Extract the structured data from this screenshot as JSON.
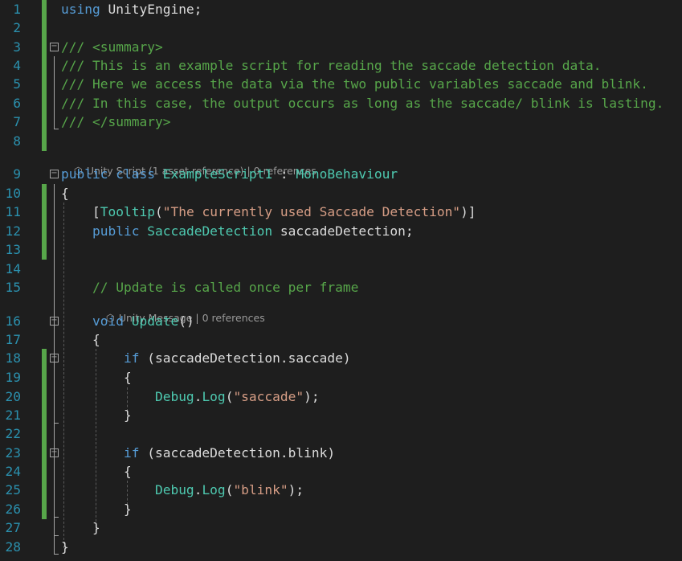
{
  "editor": {
    "lines": [
      {
        "n": "1",
        "segs": [
          {
            "c": "kw",
            "t": "using"
          },
          {
            "c": "plain",
            "t": " UnityEngine;"
          }
        ]
      },
      {
        "n": "2",
        "segs": []
      },
      {
        "n": "3",
        "segs": [
          {
            "c": "cm",
            "t": "/// <summary>"
          }
        ]
      },
      {
        "n": "4",
        "segs": [
          {
            "c": "cm",
            "t": "/// This is an example script for reading the saccade detection data."
          }
        ]
      },
      {
        "n": "5",
        "segs": [
          {
            "c": "cm",
            "t": "/// Here we access the data via the two public variables saccade and blink."
          }
        ]
      },
      {
        "n": "6",
        "segs": [
          {
            "c": "cm",
            "t": "/// In this case, the output occurs as long as the saccade/ blink is lasting."
          }
        ]
      },
      {
        "n": "7",
        "segs": [
          {
            "c": "cm",
            "t": "/// </summary>"
          }
        ]
      },
      {
        "n": "8",
        "segs": []
      },
      {
        "n": "9",
        "segs": [
          {
            "c": "kw",
            "t": "public"
          },
          {
            "c": "plain",
            "t": " "
          },
          {
            "c": "kw",
            "t": "class"
          },
          {
            "c": "plain",
            "t": " "
          },
          {
            "c": "type",
            "t": "ExampleScript1"
          },
          {
            "c": "plain",
            "t": " : "
          },
          {
            "c": "type",
            "t": "MonoBehaviour"
          }
        ]
      },
      {
        "n": "10",
        "segs": [
          {
            "c": "plain",
            "t": "{"
          }
        ]
      },
      {
        "n": "11",
        "segs": [
          {
            "c": "plain",
            "t": "    ["
          },
          {
            "c": "type",
            "t": "Tooltip"
          },
          {
            "c": "plain",
            "t": "("
          },
          {
            "c": "str",
            "t": "\"The currently used Saccade Detection\""
          },
          {
            "c": "plain",
            "t": ")]"
          }
        ]
      },
      {
        "n": "12",
        "segs": [
          {
            "c": "plain",
            "t": "    "
          },
          {
            "c": "kw",
            "t": "public"
          },
          {
            "c": "plain",
            "t": " "
          },
          {
            "c": "type",
            "t": "SaccadeDetection"
          },
          {
            "c": "plain",
            "t": " saccadeDetection;"
          }
        ]
      },
      {
        "n": "13",
        "segs": []
      },
      {
        "n": "14",
        "segs": []
      },
      {
        "n": "15",
        "segs": [
          {
            "c": "plain",
            "t": "    "
          },
          {
            "c": "cm",
            "t": "// Update is called once per frame"
          }
        ]
      },
      {
        "n": "16",
        "segs": [
          {
            "c": "plain",
            "t": "    "
          },
          {
            "c": "kw",
            "t": "void"
          },
          {
            "c": "plain",
            "t": " "
          },
          {
            "c": "type",
            "t": "Update"
          },
          {
            "c": "plain",
            "t": "()"
          }
        ]
      },
      {
        "n": "17",
        "segs": [
          {
            "c": "plain",
            "t": "    {"
          }
        ]
      },
      {
        "n": "18",
        "segs": [
          {
            "c": "plain",
            "t": "        "
          },
          {
            "c": "kw",
            "t": "if"
          },
          {
            "c": "plain",
            "t": " (saccadeDetection.saccade)"
          }
        ]
      },
      {
        "n": "19",
        "segs": [
          {
            "c": "plain",
            "t": "        {"
          }
        ]
      },
      {
        "n": "20",
        "segs": [
          {
            "c": "plain",
            "t": "            "
          },
          {
            "c": "type",
            "t": "Debug"
          },
          {
            "c": "plain",
            "t": "."
          },
          {
            "c": "type",
            "t": "Log"
          },
          {
            "c": "plain",
            "t": "("
          },
          {
            "c": "str",
            "t": "\"saccade\""
          },
          {
            "c": "plain",
            "t": ");"
          }
        ]
      },
      {
        "n": "21",
        "segs": [
          {
            "c": "plain",
            "t": "        }"
          }
        ]
      },
      {
        "n": "22",
        "segs": []
      },
      {
        "n": "23",
        "segs": [
          {
            "c": "plain",
            "t": "        "
          },
          {
            "c": "kw",
            "t": "if"
          },
          {
            "c": "plain",
            "t": " (saccadeDetection.blink)"
          }
        ]
      },
      {
        "n": "24",
        "segs": [
          {
            "c": "plain",
            "t": "        {"
          }
        ]
      },
      {
        "n": "25",
        "segs": [
          {
            "c": "plain",
            "t": "            "
          },
          {
            "c": "type",
            "t": "Debug"
          },
          {
            "c": "plain",
            "t": "."
          },
          {
            "c": "type",
            "t": "Log"
          },
          {
            "c": "plain",
            "t": "("
          },
          {
            "c": "str",
            "t": "\"blink\""
          },
          {
            "c": "plain",
            "t": ");"
          }
        ]
      },
      {
        "n": "26",
        "segs": [
          {
            "c": "plain",
            "t": "        }"
          }
        ]
      },
      {
        "n": "27",
        "segs": [
          {
            "c": "plain",
            "t": "    }"
          }
        ]
      },
      {
        "n": "28",
        "segs": [
          {
            "c": "plain",
            "t": "}"
          }
        ]
      }
    ],
    "codelens": {
      "class_lens": "Unity Script (1 asset reference) | 0 references",
      "method_lens": "Unity Message | 0 references",
      "icon": "unity-cube-icon"
    },
    "colors": {
      "background": "#1e1e1e",
      "line_number": "#2b91af",
      "keyword": "#569cd6",
      "type": "#4ec9b0",
      "string": "#d69d85",
      "comment": "#57a64a",
      "change_marker": "#57a64a"
    }
  }
}
